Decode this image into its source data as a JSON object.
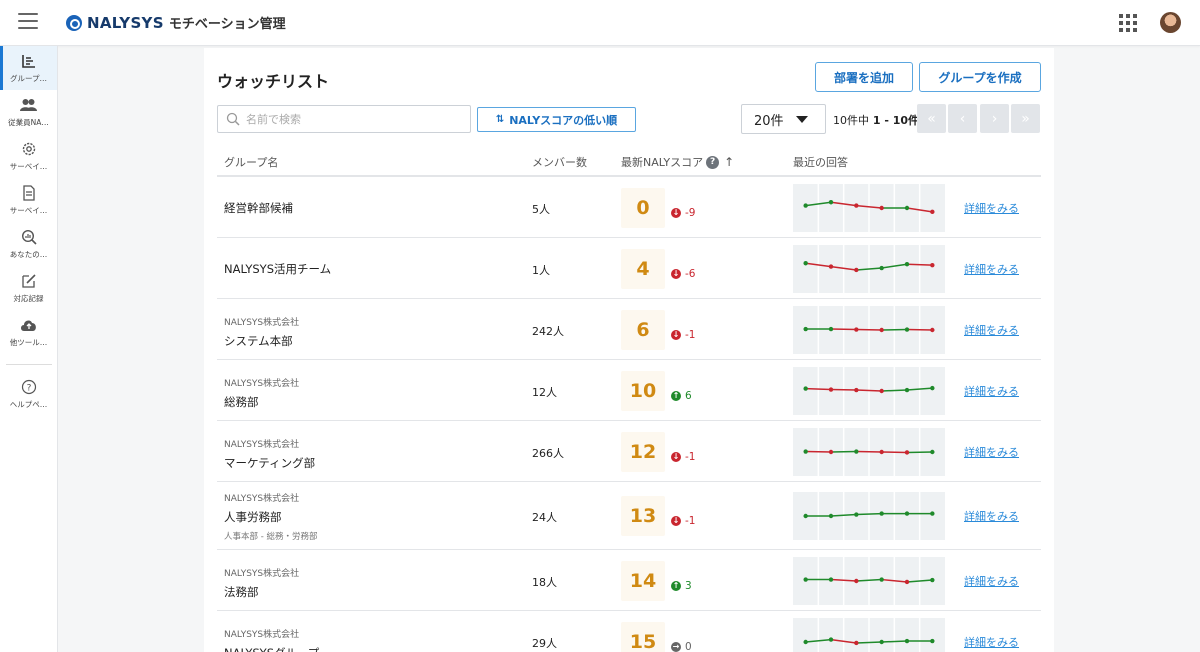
{
  "header": {
    "logo_text": "NALYSYS",
    "logo_sub": "モチベーション管理",
    "menu_icon": "hamburger-icon",
    "apps_icon": "apps-grid-icon"
  },
  "sidebar": {
    "items": [
      {
        "label": "グループ…",
        "icon": "chart-icon",
        "active": true
      },
      {
        "label": "従業員NA…",
        "icon": "people-icon"
      },
      {
        "label": "サーベイ…",
        "icon": "gear-icon"
      },
      {
        "label": "サーベイ…",
        "icon": "document-icon"
      },
      {
        "label": "あなたの…",
        "icon": "analytics-search-icon"
      },
      {
        "label": "対応記録",
        "icon": "edit-icon"
      },
      {
        "label": "他ツール…",
        "icon": "cloud-upload-icon"
      }
    ],
    "help_label": "ヘルプペ…"
  },
  "page": {
    "title": "ウォッチリスト",
    "add_member_label": "部署を追加",
    "create_group_label": "グループを作成",
    "search_placeholder": "名前で検索",
    "sort_label": "NALYスコアの低い順",
    "page_size": "20件",
    "range_prefix": "10件中",
    "range_bold": "1 - 10件"
  },
  "columns": {
    "group": "グループ名",
    "members": "メンバー数",
    "score": "最新NALYスコア",
    "recent": "最近の回答",
    "help_mark": "?",
    "sort_arrow": "↑"
  },
  "colors": {
    "accent": "#1a6fc0",
    "score": "#d08a13",
    "down": "#c9262f",
    "up": "#1f8a2b"
  },
  "rows": [
    {
      "company": "",
      "name": "経営幹部候補",
      "sub": "",
      "members": "5人",
      "score": "0",
      "delta": "-9",
      "dir": "down",
      "detail": "詳細をみる",
      "trend": [
        0.55,
        0.62,
        0.55,
        0.5,
        0.5,
        0.42
      ]
    },
    {
      "company": "",
      "name": "NALYSYS活用チーム",
      "sub": "",
      "members": "1人",
      "score": "4",
      "delta": "-6",
      "dir": "down",
      "detail": "詳細をみる",
      "trend": [
        0.62,
        0.55,
        0.48,
        0.52,
        0.6,
        0.58
      ]
    },
    {
      "company": "NALYSYS株式会社",
      "name": "システム本部",
      "sub": "",
      "members": "242人",
      "score": "6",
      "delta": "-1",
      "dir": "down",
      "detail": "詳細をみる",
      "trend": [
        0.52,
        0.52,
        0.51,
        0.5,
        0.51,
        0.5
      ]
    },
    {
      "company": "NALYSYS株式会社",
      "name": "総務部",
      "sub": "",
      "members": "12人",
      "score": "10",
      "delta": "6",
      "dir": "up",
      "detail": "詳細をみる",
      "trend": [
        0.55,
        0.53,
        0.52,
        0.5,
        0.52,
        0.56
      ]
    },
    {
      "company": "NALYSYS株式会社",
      "name": "マーケティング部",
      "sub": "",
      "members": "266人",
      "score": "12",
      "delta": "-1",
      "dir": "down",
      "detail": "詳細をみる",
      "trend": [
        0.51,
        0.5,
        0.51,
        0.5,
        0.49,
        0.5
      ]
    },
    {
      "company": "NALYSYS株式会社",
      "name": "人事労務部",
      "sub": "人事本部 - 総務・労務部",
      "members": "24人",
      "score": "13",
      "delta": "-1",
      "dir": "down",
      "detail": "詳細をみる",
      "trend": [
        0.5,
        0.5,
        0.53,
        0.55,
        0.55,
        0.55
      ]
    },
    {
      "company": "NALYSYS株式会社",
      "name": "法務部",
      "sub": "",
      "members": "18人",
      "score": "14",
      "delta": "3",
      "dir": "up",
      "detail": "詳細をみる",
      "trend": [
        0.53,
        0.53,
        0.5,
        0.53,
        0.48,
        0.52
      ]
    },
    {
      "company": "NALYSYS株式会社",
      "name": "NALYSYSグループ",
      "sub": "",
      "members": "29人",
      "score": "15",
      "delta": "0",
      "dir": "flat",
      "detail": "詳細をみる",
      "trend": [
        0.5,
        0.55,
        0.48,
        0.5,
        0.52,
        0.52
      ]
    }
  ]
}
